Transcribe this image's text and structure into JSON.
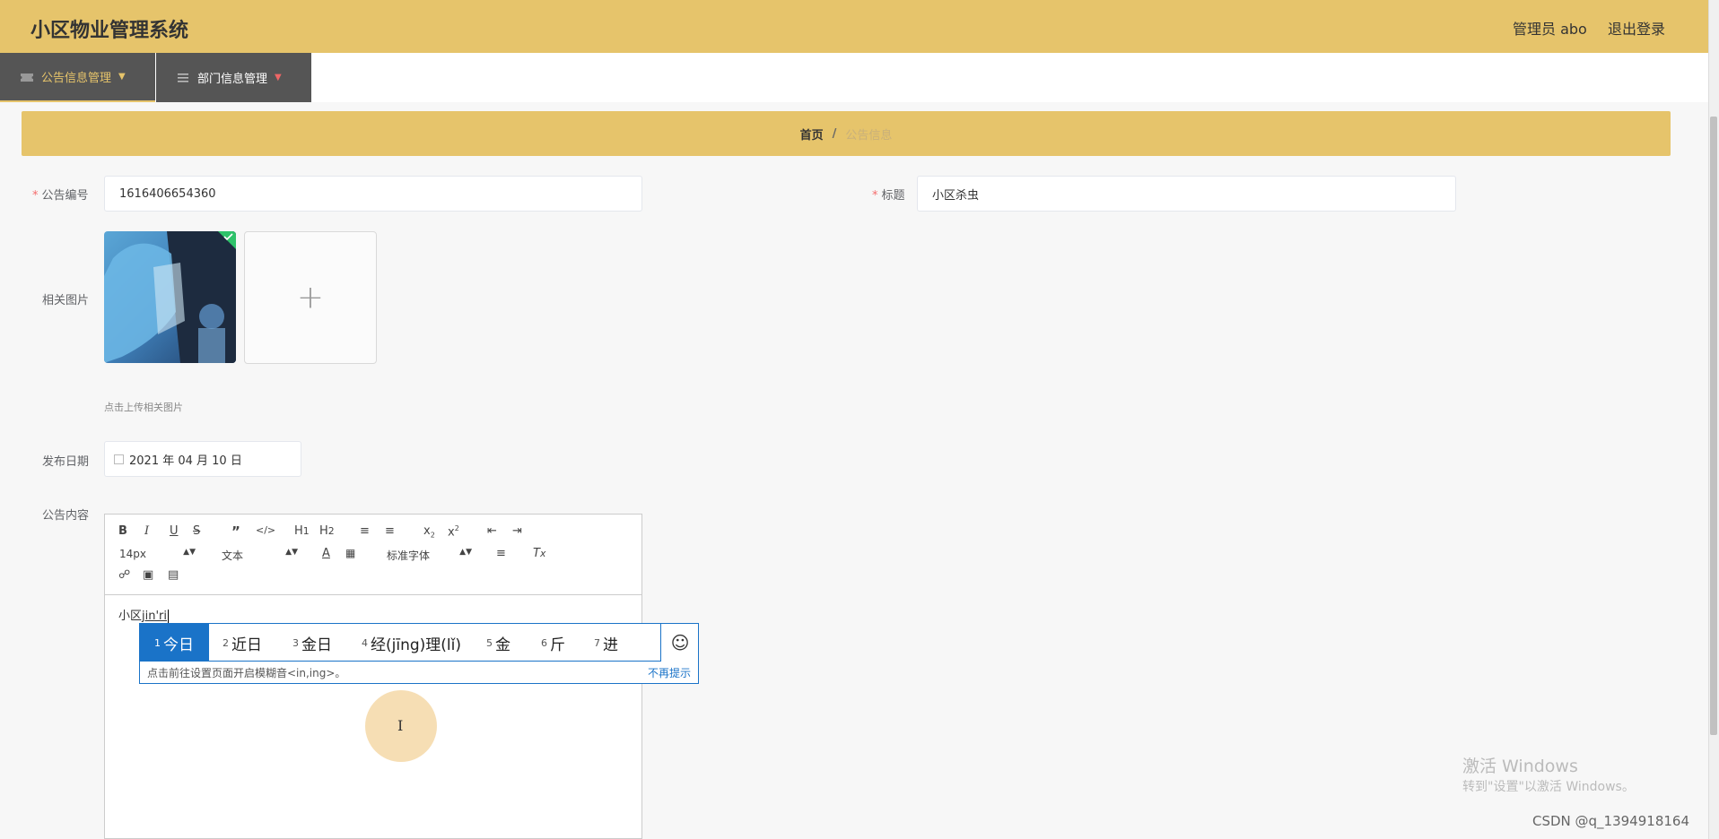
{
  "header": {
    "title": "小区物业管理系统",
    "user": "管理员 abo",
    "logout": "退出登录"
  },
  "nav": [
    {
      "label": "公告信息管理",
      "icon": "ticket-icon"
    },
    {
      "label": "部门信息管理",
      "icon": "list-icon"
    }
  ],
  "breadcrumb": {
    "home": "首页",
    "sep": "/",
    "current": "公告信息"
  },
  "form": {
    "code_label": "公告编号",
    "code_value": "1616406654360",
    "title_label": "标题",
    "title_value": "小区杀虫",
    "images_label": "相关图片",
    "upload_tip": "点击上传相关图片",
    "date_label": "发布日期",
    "date_value": "2021 年 04 月 10 日",
    "content_label": "公告内容"
  },
  "editor": {
    "font_size": "14px",
    "block": "文本",
    "font": "标准字体",
    "text_before": "小区",
    "composition": "jin'ri"
  },
  "ime": {
    "candidates": [
      {
        "num": "1",
        "text": "今日",
        "selected": true
      },
      {
        "num": "2",
        "text": "近日"
      },
      {
        "num": "3",
        "text": "金日"
      },
      {
        "num": "4",
        "text": "经(jīng)理(lǐ)"
      },
      {
        "num": "5",
        "text": "金"
      },
      {
        "num": "6",
        "text": "斤"
      },
      {
        "num": "7",
        "text": "进"
      }
    ],
    "hint": "点击前往设置页面开启模糊音<in,ing>。",
    "dismiss": "不再提示",
    "emoji_icon": "smiley-icon"
  },
  "watermark": {
    "title": "激活 Windows",
    "sub": "转到\"设置\"以激活 Windows。"
  },
  "footer": {
    "csdn": "CSDN @q_1394918164"
  },
  "colors": {
    "header": "#e6c46b",
    "nav": "#555555",
    "ime_accent": "#1a73c8"
  }
}
